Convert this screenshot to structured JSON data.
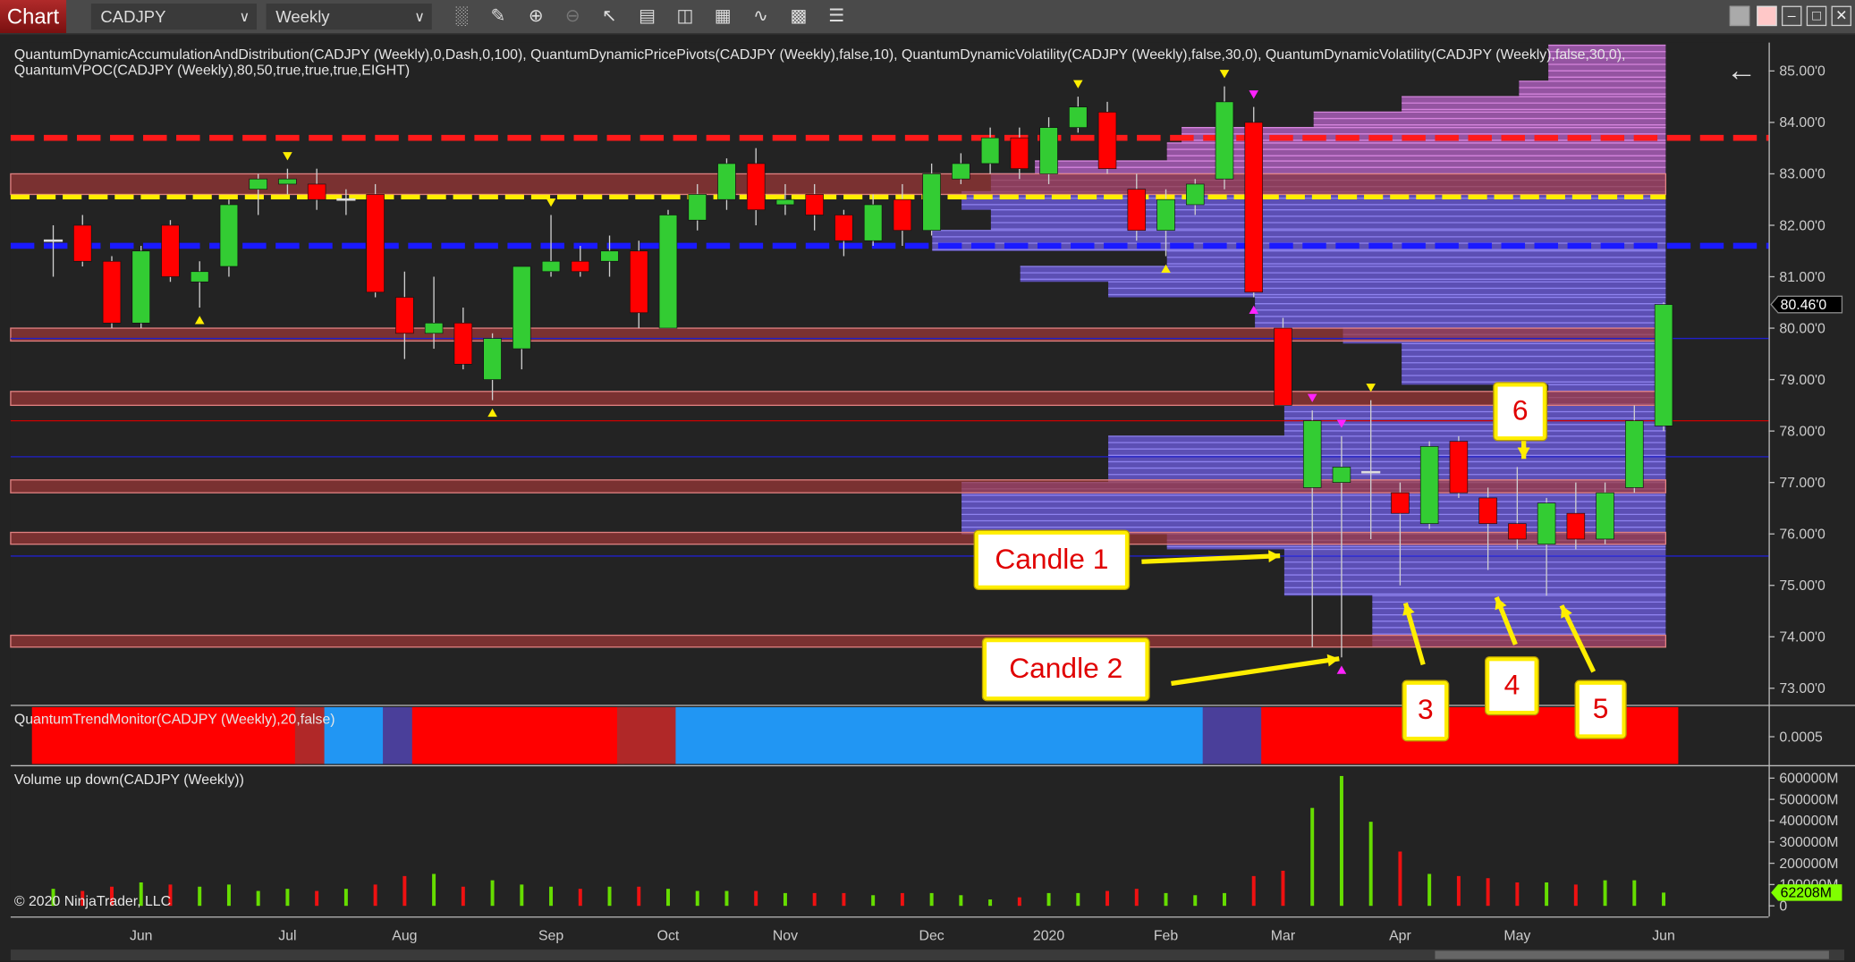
{
  "toolbar": {
    "chart_button": "Chart",
    "instrument": "CADJPY",
    "interval": "Weekly",
    "tools": [
      "bar-type-icon",
      "drawing-tool-icon",
      "zoom-in-icon",
      "zoom-out-icon",
      "pointer-icon",
      "data-box-icon",
      "properties-icon",
      "chart-trader-icon",
      "strategy-icon",
      "indicators-icon",
      "list-icon"
    ]
  },
  "indicator_labels": {
    "line1": "QuantumDynamicAccumulationAndDistribution(CADJPY (Weekly),0,Dash,0,100), QuantumDynamicPricePivots(CADJPY (Weekly),false,10), QuantumDynamicVolatility(CADJPY (Weekly),false,30,0), QuantumDynamicVolatility(CADJPY (Weekly),false,30,0),",
    "line2": "QuantumVPOC(CADJPY (Weekly),80,50,true,true,true,EIGHT)",
    "trend": "QuantumTrendMonitor(CADJPY (Weekly),20,false)",
    "volume": "Volume up down(CADJPY (Weekly))",
    "copyright": "© 2020 NinjaTrader, LLC"
  },
  "colors": {
    "up": "#33cc33",
    "down": "#ff0000",
    "vol_up": "#66dd00",
    "vol_down": "#ee1111",
    "trend_bull": "#2196f3",
    "trend_bear": "#ff0000",
    "trend_weak_bear": "#b02828",
    "trend_neutral": "#4a3f9a",
    "profile_value_area": "#6a5ad8",
    "profile_outside": "#b060c0",
    "zone": "#a03838"
  },
  "price_axis": {
    "ticks": [
      "85.00'0",
      "84.00'0",
      "83.00'0",
      "82.00'0",
      "81.00'0",
      "80.00'0",
      "79.00'0",
      "78.00'0",
      "77.00'0",
      "76.00'0",
      "75.00'0",
      "74.00'0",
      "73.00'0"
    ],
    "current_price_label": "80.46'0",
    "current_price": 80.46
  },
  "trend_axis": {
    "ticks": [
      "0.0005"
    ]
  },
  "volume_axis": {
    "ticks": [
      "600000M",
      "500000M",
      "400000M",
      "300000M",
      "200000M",
      "100000M",
      "0"
    ],
    "current_label": "62208M"
  },
  "x_axis": {
    "labels": [
      "Jun",
      "Jul",
      "Aug",
      "Sep",
      "Oct",
      "Nov",
      "Dec",
      "2020",
      "Feb",
      "Mar",
      "Apr",
      "May",
      "Jun"
    ]
  },
  "candles": [
    [
      "2019-05-12",
      81.7,
      82.0,
      81.0,
      81.7,
      80000
    ],
    [
      "2019-05-19",
      82.0,
      82.2,
      81.2,
      81.3,
      70000
    ],
    [
      "2019-05-26",
      81.3,
      81.4,
      80.0,
      80.1,
      90000
    ],
    [
      "2019-06-02",
      80.1,
      81.6,
      80.0,
      81.5,
      110000
    ],
    [
      "2019-06-09",
      82.0,
      82.1,
      80.9,
      81.0,
      100000
    ],
    [
      "2019-06-16",
      80.9,
      81.3,
      80.4,
      81.1,
      90000
    ],
    [
      "2019-06-23",
      81.2,
      82.5,
      81.0,
      82.4,
      100000
    ],
    [
      "2019-06-30",
      82.7,
      83.0,
      82.2,
      82.9,
      70000
    ],
    [
      "2019-07-07",
      82.8,
      83.1,
      82.6,
      82.9,
      80000
    ],
    [
      "2019-07-14",
      82.8,
      83.1,
      82.3,
      82.5,
      70000
    ],
    [
      "2019-07-21",
      82.5,
      82.7,
      82.2,
      82.5,
      80000
    ],
    [
      "2019-07-28",
      82.6,
      82.8,
      80.6,
      80.7,
      100000
    ],
    [
      "2019-08-04",
      80.6,
      81.1,
      79.4,
      79.9,
      140000
    ],
    [
      "2019-08-11",
      79.9,
      81.0,
      79.6,
      80.1,
      150000
    ],
    [
      "2019-08-18",
      80.1,
      80.4,
      79.2,
      79.3,
      90000
    ],
    [
      "2019-08-25",
      79.0,
      79.9,
      78.6,
      79.8,
      120000
    ],
    [
      "2019-09-01",
      79.6,
      81.2,
      79.2,
      81.2,
      100000
    ],
    [
      "2019-09-08",
      81.1,
      82.2,
      81.0,
      81.3,
      90000
    ],
    [
      "2019-09-15",
      81.3,
      81.6,
      81.0,
      81.1,
      80000
    ],
    [
      "2019-09-22",
      81.3,
      81.8,
      81.0,
      81.5,
      90000
    ],
    [
      "2019-09-29",
      81.5,
      81.7,
      80.0,
      80.3,
      90000
    ],
    [
      "2019-10-06",
      80.0,
      82.3,
      80.0,
      82.2,
      80000
    ],
    [
      "2019-10-13",
      82.1,
      82.8,
      81.9,
      82.6,
      70000
    ],
    [
      "2019-10-20",
      82.5,
      83.3,
      82.3,
      83.2,
      70000
    ],
    [
      "2019-10-27",
      83.2,
      83.5,
      82.0,
      82.3,
      70000
    ],
    [
      "2019-11-03",
      82.4,
      82.8,
      82.2,
      82.5,
      60000
    ],
    [
      "2019-11-10",
      82.6,
      82.8,
      81.9,
      82.2,
      60000
    ],
    [
      "2019-11-17",
      82.2,
      82.3,
      81.4,
      81.7,
      60000
    ],
    [
      "2019-11-24",
      81.7,
      82.6,
      81.6,
      82.4,
      50000
    ],
    [
      "2019-12-01",
      82.5,
      82.8,
      81.6,
      81.9,
      60000
    ],
    [
      "2019-12-08",
      81.9,
      83.2,
      81.8,
      83.0,
      60000
    ],
    [
      "2019-12-15",
      82.9,
      83.4,
      82.8,
      83.2,
      50000
    ],
    [
      "2019-12-22",
      83.2,
      83.9,
      83.0,
      83.7,
      30000
    ],
    [
      "2019-12-29",
      83.7,
      83.9,
      82.9,
      83.1,
      40000
    ],
    [
      "2020-01-05",
      83.0,
      84.1,
      82.8,
      83.9,
      60000
    ],
    [
      "2020-01-12",
      83.9,
      84.5,
      83.8,
      84.3,
      60000
    ],
    [
      "2020-01-19",
      84.2,
      84.4,
      83.0,
      83.1,
      70000
    ],
    [
      "2020-01-26",
      82.7,
      83.0,
      81.7,
      81.9,
      80000
    ],
    [
      "2020-02-02",
      81.9,
      82.7,
      81.4,
      82.5,
      60000
    ],
    [
      "2020-02-09",
      82.4,
      82.9,
      82.2,
      82.8,
      50000
    ],
    [
      "2020-02-16",
      82.9,
      84.7,
      82.7,
      84.4,
      60000
    ],
    [
      "2020-02-23",
      84.0,
      84.3,
      80.6,
      80.7,
      140000
    ],
    [
      "2020-03-01",
      80.0,
      80.2,
      78.5,
      78.5,
      165000
    ],
    [
      "2020-03-08",
      76.9,
      78.4,
      73.8,
      78.2,
      460000
    ],
    [
      "2020-03-15",
      77.0,
      77.9,
      73.6,
      77.3,
      610000
    ],
    [
      "2020-03-22",
      77.2,
      78.6,
      75.9,
      77.2,
      395000
    ],
    [
      "2020-03-29",
      76.8,
      77.0,
      75.0,
      76.4,
      255000
    ],
    [
      "2020-04-05",
      76.2,
      77.8,
      76.1,
      77.7,
      150000
    ],
    [
      "2020-04-12",
      77.8,
      77.9,
      76.7,
      76.8,
      140000
    ],
    [
      "2020-04-19",
      76.7,
      76.9,
      75.3,
      76.2,
      130000
    ],
    [
      "2020-04-26",
      76.2,
      77.3,
      75.7,
      75.9,
      110000
    ],
    [
      "2020-05-03",
      75.8,
      76.7,
      74.8,
      76.6,
      110000
    ],
    [
      "2020-05-10",
      76.4,
      77.0,
      75.7,
      75.9,
      100000
    ],
    [
      "2020-05-17",
      75.9,
      77.0,
      75.8,
      76.8,
      120000
    ],
    [
      "2020-05-24",
      76.9,
      78.5,
      76.8,
      78.2,
      120000
    ],
    [
      "2020-05-31",
      78.1,
      80.5,
      78.0,
      80.46,
      62208
    ]
  ],
  "levels": {
    "resistance_dashed": 83.7,
    "vpoc_dashed": 82.55,
    "support_dashed": 81.6,
    "zones": [
      [
        82.6,
        83.0
      ],
      [
        79.75,
        80.0
      ],
      [
        78.5,
        78.77
      ],
      [
        76.8,
        77.05
      ],
      [
        75.8,
        76.03
      ],
      [
        73.8,
        74.03
      ]
    ],
    "thin_lines": [
      {
        "price": 78.2,
        "color": "#cc0000"
      },
      {
        "price": 77.5,
        "color": "#2020cc"
      },
      {
        "price": 75.57,
        "color": "#2020cc"
      },
      {
        "price": 79.8,
        "color": "#2020cc"
      }
    ]
  },
  "volume_profile": [
    [
      84.8,
      85.5,
      0.16,
      "outside"
    ],
    [
      84.5,
      84.8,
      0.2,
      "outside"
    ],
    [
      84.2,
      84.5,
      0.36,
      "outside"
    ],
    [
      83.9,
      84.2,
      0.48,
      "outside"
    ],
    [
      83.6,
      83.9,
      0.66,
      "outside"
    ],
    [
      83.25,
      83.6,
      0.68,
      "outside"
    ],
    [
      83.0,
      83.25,
      0.86,
      "outside"
    ],
    [
      82.65,
      83.0,
      0.92,
      "value"
    ],
    [
      82.3,
      82.65,
      0.96,
      "value"
    ],
    [
      81.9,
      82.3,
      0.92,
      "value"
    ],
    [
      81.5,
      81.9,
      1.0,
      "value"
    ],
    [
      81.2,
      81.5,
      0.68,
      "value"
    ],
    [
      80.9,
      81.2,
      0.88,
      "value"
    ],
    [
      80.6,
      80.9,
      0.76,
      "value"
    ],
    [
      80.0,
      80.6,
      0.56,
      "value"
    ],
    [
      79.7,
      80.0,
      0.44,
      "value"
    ],
    [
      78.9,
      79.7,
      0.36,
      "value"
    ],
    [
      78.5,
      78.9,
      0.16,
      "value"
    ],
    [
      77.9,
      78.5,
      0.52,
      "value"
    ],
    [
      77.0,
      77.9,
      0.76,
      "value"
    ],
    [
      76.0,
      77.0,
      0.96,
      "value"
    ],
    [
      75.7,
      76.0,
      0.68,
      "value"
    ],
    [
      74.8,
      75.7,
      0.52,
      "value"
    ],
    [
      73.8,
      74.8,
      0.4,
      "value"
    ]
  ],
  "trend_segments": [
    [
      0,
      8,
      "bear"
    ],
    [
      9,
      9,
      "weak_bear"
    ],
    [
      10,
      11,
      "bull"
    ],
    [
      12,
      12,
      "neutral"
    ],
    [
      13,
      19,
      "bear"
    ],
    [
      20,
      21,
      "weak_bear"
    ],
    [
      22,
      39,
      "bull"
    ],
    [
      40,
      41,
      "neutral"
    ],
    [
      42,
      55,
      "bear"
    ]
  ],
  "pivots": [
    [
      8,
      "high",
      "yellow"
    ],
    [
      17,
      "high",
      "yellow"
    ],
    [
      35,
      "high",
      "yellow"
    ],
    [
      40,
      "high",
      "yellow"
    ],
    [
      45,
      "high",
      "yellow"
    ],
    [
      5,
      "low",
      "yellow"
    ],
    [
      15,
      "low",
      "yellow"
    ],
    [
      38,
      "low",
      "yellow"
    ],
    [
      41,
      "high",
      "magenta"
    ],
    [
      43,
      "high",
      "magenta"
    ],
    [
      44,
      "high",
      "magenta"
    ],
    [
      41,
      "low",
      "magenta"
    ],
    [
      44,
      "low",
      "magenta"
    ]
  ],
  "annotations": {
    "candle1": "Candle 1",
    "candle2": "Candle 2",
    "n3": "3",
    "n4": "4",
    "n5": "5",
    "n6": "6"
  }
}
